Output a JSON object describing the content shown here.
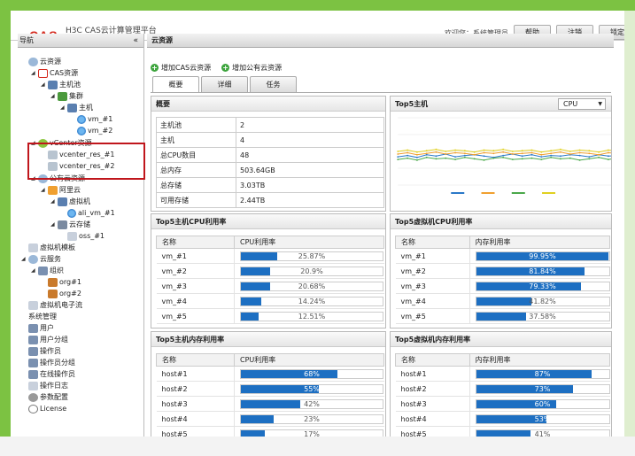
{
  "header": {
    "logo": "CAS",
    "app_title": "H3C CAS云计算管理平台",
    "welcome": "欢迎您：系统管理员",
    "buttons": [
      "帮助",
      "注销",
      "锁定"
    ]
  },
  "sidebar": {
    "title": "导航",
    "collapse": "«",
    "items": [
      {
        "label": "云资源"
      },
      {
        "label": "CAS资源"
      },
      {
        "label": "主机池"
      },
      {
        "label": "集群"
      },
      {
        "label": "主机"
      },
      {
        "label": "vm_#1"
      },
      {
        "label": "vm_#2"
      },
      {
        "label": "vCenter资源"
      },
      {
        "label": "vcenter_res_#1"
      },
      {
        "label": "vcenter_res_#2"
      },
      {
        "label": "公有云资源"
      },
      {
        "label": "阿里云"
      },
      {
        "label": "虚拟机"
      },
      {
        "label": "ali_vm_#1"
      },
      {
        "label": "云存储"
      },
      {
        "label": "oss_#1"
      },
      {
        "label": "虚拟机模板"
      },
      {
        "label": "云服务"
      },
      {
        "label": "组织"
      },
      {
        "label": "org#1"
      },
      {
        "label": "org#2"
      },
      {
        "label": "虚拟机电子流"
      },
      {
        "label": "系统管理"
      },
      {
        "label": "用户"
      },
      {
        "label": "用户分组"
      },
      {
        "label": "操作员"
      },
      {
        "label": "操作员分组"
      },
      {
        "label": "在线操作员"
      },
      {
        "label": "操作日志"
      },
      {
        "label": "参数配置"
      },
      {
        "label": "License"
      }
    ]
  },
  "main": {
    "title": "云资源",
    "toolbar": {
      "add_cas": "增加CAS云资源",
      "add_public": "增加公有云资源"
    },
    "tabs": [
      "概要",
      "详细",
      "任务"
    ],
    "summary": {
      "title": "概要",
      "rows": [
        {
          "key": "主机池",
          "value": "2"
        },
        {
          "key": "主机",
          "value": "4"
        },
        {
          "key": "总CPU数目",
          "value": "48"
        },
        {
          "key": "总内存",
          "value": "503.64GB"
        },
        {
          "key": "总存储",
          "value": "3.03TB"
        },
        {
          "key": "可用存储",
          "value": "2.44TB"
        }
      ]
    },
    "top5_host_panel": {
      "title": "Top5主机",
      "select_value": "CPU"
    },
    "host_cpu": {
      "title": "Top5主机CPU利用率",
      "col_name": "名称",
      "col_value": "CPU利用率",
      "rows": [
        {
          "name": "vm_#1",
          "label": "25.87%",
          "value": 25.87
        },
        {
          "name": "vm_#2",
          "label": "20.9%",
          "value": 20.9
        },
        {
          "name": "vm_#3",
          "label": "20.68%",
          "value": 20.68
        },
        {
          "name": "vm_#4",
          "label": "14.24%",
          "value": 14.24
        },
        {
          "name": "vm_#5",
          "label": "12.51%",
          "value": 12.51
        }
      ]
    },
    "vm_cpu": {
      "title": "Top5虚拟机CPU利用率",
      "col_name": "名称",
      "col_value": "内存利用率",
      "rows": [
        {
          "name": "vm_#1",
          "label": "99.95%",
          "value": 99.95
        },
        {
          "name": "vm_#2",
          "label": "81.84%",
          "value": 81.84
        },
        {
          "name": "vm_#3",
          "label": "79.33%",
          "value": 79.33
        },
        {
          "name": "vm_#4",
          "label": "41.82%",
          "value": 41.82
        },
        {
          "name": "vm_#5",
          "label": "37.58%",
          "value": 37.58
        }
      ]
    },
    "host_mem": {
      "title": "Top5主机内存利用率",
      "col_name": "名称",
      "col_value": "CPU利用率",
      "rows": [
        {
          "name": "host#1",
          "label": "68%",
          "value": 68
        },
        {
          "name": "host#2",
          "label": "55%",
          "value": 55
        },
        {
          "name": "host#3",
          "label": "42%",
          "value": 42
        },
        {
          "name": "host#4",
          "label": "23%",
          "value": 23
        },
        {
          "name": "host#5",
          "label": "17%",
          "value": 17
        }
      ]
    },
    "vm_mem": {
      "title": "Top5虚拟机内存利用率",
      "col_name": "名称",
      "col_value": "内存利用率",
      "rows": [
        {
          "name": "host#1",
          "label": "87%",
          "value": 87
        },
        {
          "name": "host#2",
          "label": "73%",
          "value": 73
        },
        {
          "name": "host#3",
          "label": "60%",
          "value": 60
        },
        {
          "name": "host#4",
          "label": "53%",
          "value": 53
        },
        {
          "name": "host#5",
          "label": "41%",
          "value": 41
        }
      ]
    }
  },
  "chart_data": {
    "type": "line",
    "ylim": [
      0,
      100
    ],
    "series": [
      {
        "color": "#2a78c8",
        "values": [
          42,
          44,
          41,
          45,
          43,
          46,
          42,
          44,
          45,
          43,
          41,
          44,
          46,
          43,
          45,
          42,
          44,
          43,
          45,
          44,
          42,
          45,
          43,
          44
        ]
      },
      {
        "color": "#f0a030",
        "values": [
          46,
          48,
          45,
          47,
          49,
          46,
          48,
          47,
          45,
          48,
          47,
          49,
          46,
          47,
          48,
          45,
          47,
          49,
          46,
          48,
          47,
          45,
          48,
          47
        ]
      },
      {
        "color": "#4aa84a",
        "values": [
          38,
          40,
          37,
          41,
          39,
          40,
          38,
          41,
          39,
          37,
          40,
          41,
          38,
          39,
          40,
          38,
          41,
          39,
          40,
          37,
          39,
          41,
          38,
          40
        ]
      },
      {
        "color": "#e0d020",
        "values": [
          50,
          52,
          49,
          51,
          53,
          50,
          52,
          51,
          49,
          52,
          51,
          53,
          50,
          51,
          52,
          49,
          51,
          53,
          50,
          52,
          51,
          49,
          52,
          51
        ]
      }
    ]
  },
  "colors": {
    "accent": "#1d6fc2",
    "highlight_border": "#c0161c",
    "frame": "#7cc242"
  }
}
